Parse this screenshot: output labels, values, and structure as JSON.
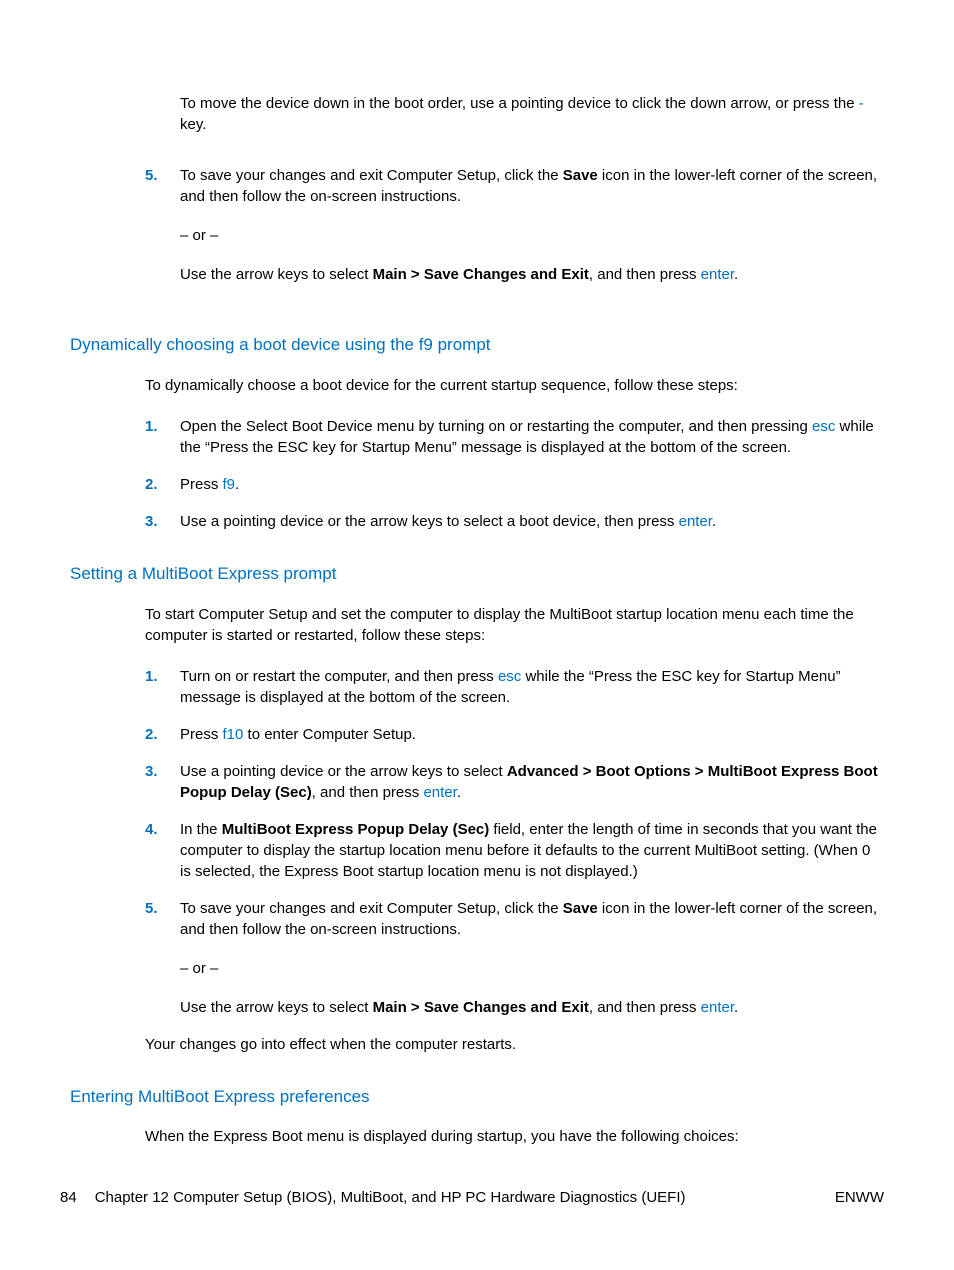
{
  "intro": {
    "p1_a": "To move the device down in the boot order, use a pointing device to click the down arrow, or press the ",
    "p1_key": "-",
    "p1_b": " key."
  },
  "step5": {
    "num": "5.",
    "p1_a": "To save your changes and exit Computer Setup, click the ",
    "p1_bold": "Save",
    "p1_b": " icon in the lower-left corner of the screen, and then follow the on-screen instructions.",
    "or": "– or –",
    "p2_a": "Use the arrow keys to select ",
    "p2_bold": "Main > Save Changes and Exit",
    "p2_b": ", and then press ",
    "p2_kw": "enter",
    "p2_c": "."
  },
  "sec1": {
    "heading": "Dynamically choosing a boot device using the f9 prompt",
    "intro": "To dynamically choose a boot device for the current startup sequence, follow these steps:",
    "s1": {
      "num": "1.",
      "a": "Open the Select Boot Device menu by turning on or restarting the computer, and then pressing ",
      "kw": "esc",
      "b": " while the “Press the ESC key for Startup Menu” message is displayed at the bottom of the screen."
    },
    "s2": {
      "num": "2.",
      "a": "Press ",
      "kw": "f9",
      "b": "."
    },
    "s3": {
      "num": "3.",
      "a": "Use a pointing device or the arrow keys to select a boot device, then press ",
      "kw": "enter",
      "b": "."
    }
  },
  "sec2": {
    "heading": "Setting a MultiBoot Express prompt",
    "intro": "To start Computer Setup and set the computer to display the MultiBoot startup location menu each time the computer is started or restarted, follow these steps:",
    "s1": {
      "num": "1.",
      "a": "Turn on or restart the computer, and then press ",
      "kw": "esc",
      "b": " while the “Press the ESC key for Startup Menu” message is displayed at the bottom of the screen."
    },
    "s2": {
      "num": "2.",
      "a": "Press ",
      "kw": "f10",
      "b": " to enter Computer Setup."
    },
    "s3": {
      "num": "3.",
      "a": "Use a pointing device or the arrow keys to select ",
      "bold": "Advanced > Boot Options > MultiBoot Express Boot Popup Delay (Sec)",
      "b": ", and then press ",
      "kw": "enter",
      "c": "."
    },
    "s4": {
      "num": "4.",
      "a": "In the ",
      "bold": "MultiBoot Express Popup Delay (Sec)",
      "b": " field, enter the length of time in seconds that you want the computer to display the startup location menu before it defaults to the current MultiBoot setting. (When 0 is selected, the Express Boot startup location menu is not displayed.)"
    },
    "s5": {
      "num": "5.",
      "a": "To save your changes and exit Computer Setup, click the ",
      "bold": "Save",
      "b": " icon in the lower-left corner of the screen, and then follow the on-screen instructions.",
      "or": "– or –",
      "c": "Use the arrow keys to select ",
      "bold2": "Main > Save Changes and Exit",
      "d": ", and then press ",
      "kw": "enter",
      "e": "."
    },
    "outro": "Your changes go into effect when the computer restarts."
  },
  "sec3": {
    "heading": "Entering MultiBoot Express preferences",
    "intro": "When the Express Boot menu is displayed during startup, you have the following choices:"
  },
  "footer": {
    "page": "84",
    "chapter": "Chapter 12   Computer Setup (BIOS), MultiBoot, and HP PC Hardware Diagnostics (UEFI)",
    "right": "ENWW"
  }
}
